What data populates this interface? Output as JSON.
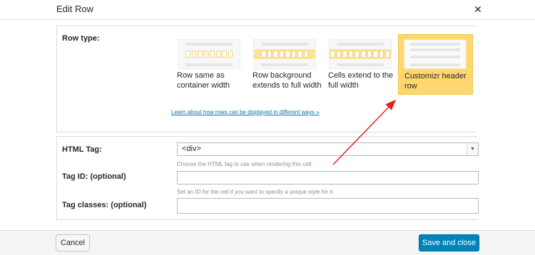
{
  "modal": {
    "title": "Edit Row",
    "close_icon": "close-icon"
  },
  "row_type": {
    "label": "Row type:",
    "options": [
      {
        "caption": "Row same as container width",
        "selected": false
      },
      {
        "caption": "Row background extends to full width",
        "selected": false
      },
      {
        "caption": "Cells extend to the full width",
        "selected": false
      },
      {
        "caption": "Customizr header row",
        "selected": true
      }
    ],
    "learn_more_link": "Learn about how rows can be displayed in different ways »"
  },
  "fields": {
    "html_tag": {
      "label": "HTML Tag:",
      "value": "<div>",
      "help": "Choose the HTML tag to use when rendering this cell."
    },
    "tag_id": {
      "label": "Tag ID: (optional)",
      "value": "",
      "help": "Set an ID for the cell if you want to specify a unique style for it."
    },
    "tag_classes": {
      "label": "Tag classes: (optional)",
      "value": ""
    }
  },
  "footer": {
    "cancel_label": "Cancel",
    "save_label": "Save and close"
  },
  "colors": {
    "accent": "#0085ba",
    "selected_bg": "#ffd76e",
    "annotation_arrow": "#e02020"
  }
}
